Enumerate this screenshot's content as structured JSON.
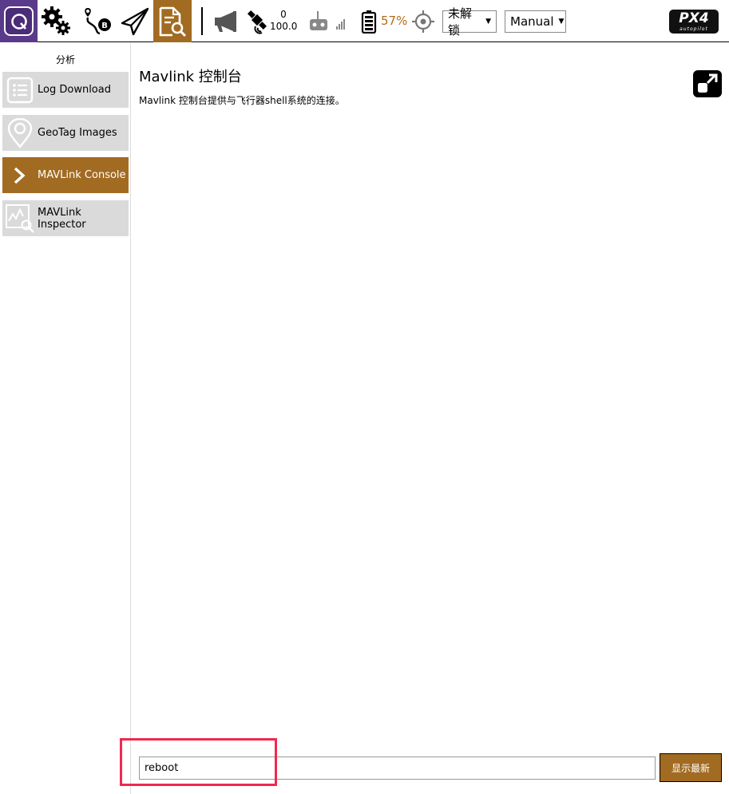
{
  "toolbar": {
    "icons": {
      "qgc": "qgc-logo-icon",
      "settings": "gears-icon",
      "plan": "route-icon",
      "fly": "paper-plane-icon",
      "analyze": "analyze-icon",
      "messages": "megaphone-icon",
      "gps": "satellite-icon",
      "rc": "rc-transmitter-icon",
      "battery": "battery-icon",
      "gnss": "crosshair-icon"
    },
    "gps_count": "0",
    "gps_hdop": "100.0",
    "battery_percent": "57%",
    "arm_status": "未解锁",
    "flight_mode": "Manual",
    "brand": "PX4",
    "brand_sub": "autopilot"
  },
  "sidebar": {
    "title": "分析",
    "items": [
      {
        "label": "Log Download",
        "icon": "list-icon",
        "active": false
      },
      {
        "label": "GeoTag Images",
        "icon": "map-pin-icon",
        "active": false
      },
      {
        "label": "MAVLink Console",
        "icon": "chevron-right-icon",
        "active": true
      },
      {
        "label": "MAVLink Inspector",
        "icon": "chart-search-icon",
        "active": false
      }
    ]
  },
  "main": {
    "title": "Mavlink 控制台",
    "description": "Mavlink 控制台提供与飞行器shell系统的连接。",
    "command_value": "reboot",
    "show_latest_label": "显示最新"
  },
  "colors": {
    "accent": "#a26b22",
    "qgc_purple": "#5a3a8a",
    "highlight": "#f0284e",
    "battery_text": "#b26a1a"
  }
}
